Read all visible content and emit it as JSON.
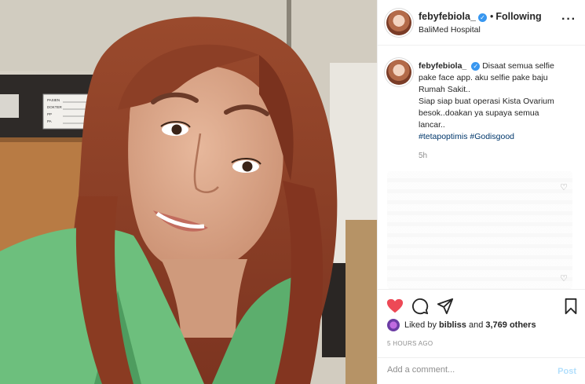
{
  "post": {
    "username": "febyfebiola_",
    "follow_status": "Following",
    "location": "BaliMed Hospital",
    "more_icon": "more-options-icon",
    "caption_lines": [
      "Disaat semua selfie",
      "pake face app. aku selfie pake baju",
      "Rumah Sakit..",
      "Siap siap buat operasi Kista Ovarium",
      "besok..doakan ya supaya semua",
      "lancar.."
    ],
    "hashtags": [
      "#tetapoptimis",
      "#Godisgood"
    ],
    "caption_time": "5h",
    "liked_by_prefix": "Liked by",
    "liked_by_user": "bibliss",
    "liked_by_and": "and",
    "likes_count": "3,769 others",
    "post_time": "5 HOURS AGO",
    "liked": true
  },
  "photo": {
    "board_rows": [
      "PASIEN",
      "DOKTER",
      "PP",
      "PA"
    ]
  },
  "comment_box": {
    "placeholder": "Add a comment...",
    "post_label": "Post"
  },
  "colors": {
    "accent": "#3897f0",
    "like_red": "#ed4956",
    "post_disabled": "#b2dffc",
    "hashtag": "#00376b"
  }
}
